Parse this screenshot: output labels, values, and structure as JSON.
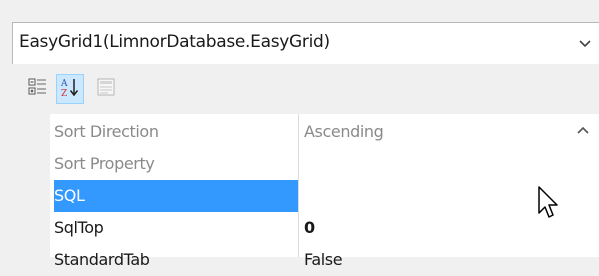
{
  "object_selector": {
    "value": "EasyGrid1(LimnorDatabase.EasyGrid)"
  },
  "toolbar": {
    "buttons": [
      {
        "icon": "categorized-icon",
        "active": false
      },
      {
        "icon": "sort-alphabetical-icon",
        "active": true
      },
      {
        "icon": "property-pages-icon",
        "active": false
      }
    ]
  },
  "properties": [
    {
      "name": "Sort Direction",
      "value": "Ascending",
      "state": "muted"
    },
    {
      "name": "Sort Property",
      "value": "",
      "state": "muted"
    },
    {
      "name": "SQL",
      "value": "",
      "state": "selected",
      "has_ellipsis": true,
      "ellipsis_label": "..."
    },
    {
      "name": "SqlTop",
      "value": "0",
      "state": "plain"
    },
    {
      "name": "StandardTab",
      "value": "False",
      "state": "plain"
    }
  ],
  "colors": {
    "selection": "#3399ff",
    "toolbar_active": "#cce8ff",
    "muted_text": "#8a8a8a"
  }
}
